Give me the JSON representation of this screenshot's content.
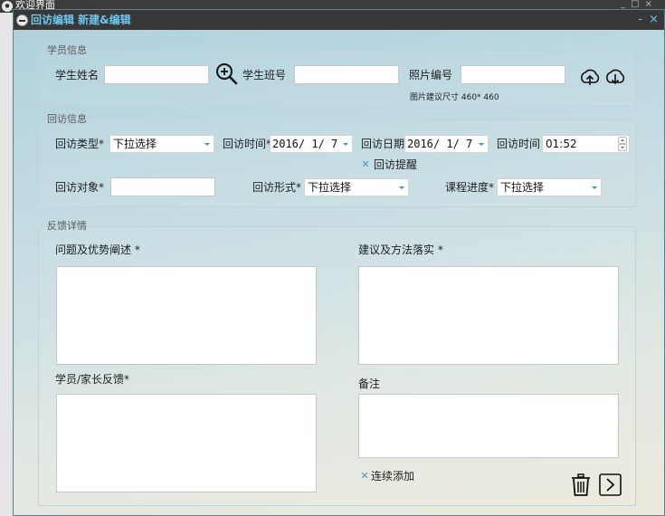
{
  "background_window": {
    "title": "欢迎界面"
  },
  "dialog": {
    "title": "回访编辑 新建&编辑",
    "minimize": "-",
    "close": "×"
  },
  "student_info": {
    "legend": "学员信息",
    "name_label": "学生姓名",
    "name_value": "",
    "class_label": "学生班号",
    "class_value": "",
    "photo_label": "照片编号",
    "photo_value": "",
    "photo_hint": "图片建议尺寸 460* 460",
    "icons": [
      "zoom-in-icon",
      "upload-icon",
      "download-icon"
    ]
  },
  "visit_info": {
    "legend": "回访信息",
    "type_label": "回访类型*",
    "type_value": "下拉选择",
    "time_label": "回访时间*",
    "time_value": "2016/ 1/ 7",
    "date_label": "回访日期",
    "date_value": "2016/ 1/ 7",
    "clock_label": "回访时间",
    "clock_value": "01:52",
    "reminder_label": "回访提醒",
    "reminder_checked": true,
    "target_label": "回访对象*",
    "target_value": "",
    "form_label": "回访形式*",
    "form_value": "下拉选择",
    "progress_label": "课程进度*",
    "progress_value": "下拉选择"
  },
  "feedback": {
    "legend": "反馈详情",
    "problems_label": "问题及优势阐述 *",
    "suggestions_label": "建议及方法落实 *",
    "parent_feedback_label": "学员/家长反馈*",
    "remarks_label": "备注",
    "continuous_add_label": "连续添加",
    "continuous_add_checked": true
  },
  "colors": {
    "title_accent": "#6bc6ee",
    "dropdown_arrow": "#3b8fd1",
    "titlebar": "#383838"
  }
}
